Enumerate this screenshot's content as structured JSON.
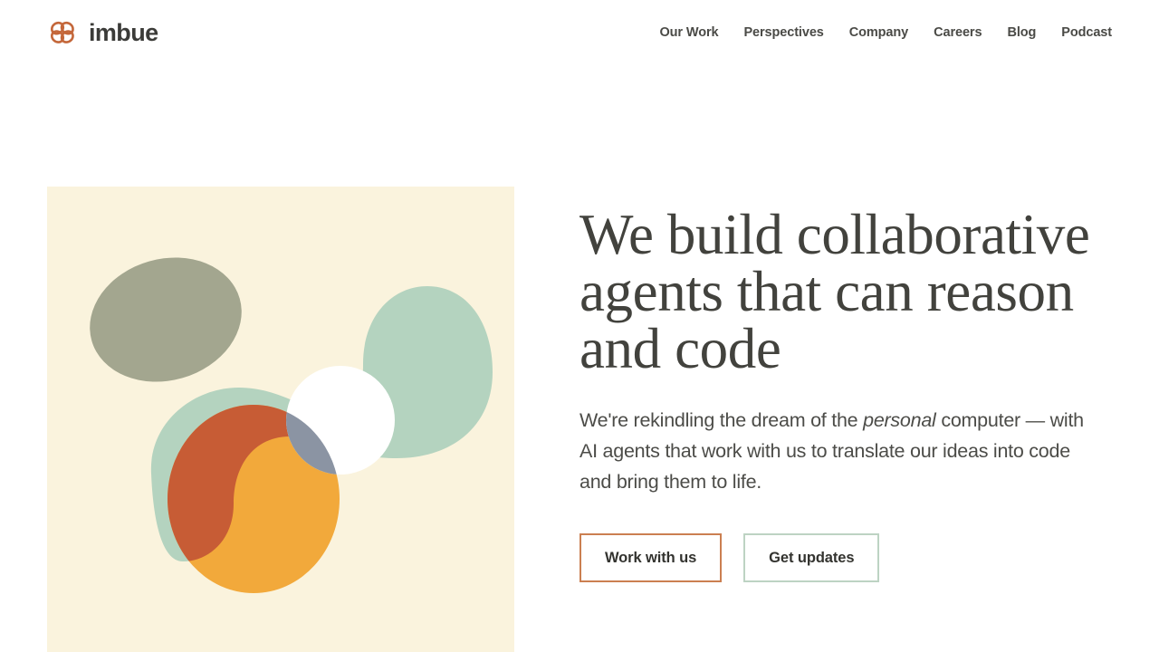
{
  "brand": {
    "name": "imbue",
    "logo_icon": "imbue-knot-icon",
    "logo_color": "#c4673a",
    "wordmark_color": "#3b3b38"
  },
  "nav": {
    "items": [
      {
        "label": "Our Work"
      },
      {
        "label": "Perspectives"
      },
      {
        "label": "Company"
      },
      {
        "label": "Careers"
      },
      {
        "label": "Blog"
      },
      {
        "label": "Podcast"
      }
    ]
  },
  "hero": {
    "title": "We build collaborative agents that can reason and code",
    "subtitle_part1": "We're rekindling the dream of the ",
    "subtitle_emphasis": "personal",
    "subtitle_part2": " computer — with AI agents that work with us to translate our ideas into code and bring them to life.",
    "buttons": [
      {
        "label": "Work with us",
        "border_color": "#cb7f51"
      },
      {
        "label": "Get updates",
        "border_color": "#bdd3c3"
      }
    ],
    "illustration": {
      "name": "abstract-overlapping-shapes-illustration",
      "background_color": "#faf3dd",
      "shapes": [
        {
          "name": "sage-grey-ellipse",
          "color": "#a3a68f"
        },
        {
          "name": "mint-wave-blob",
          "color": "#b4d3bf"
        },
        {
          "name": "white-circle",
          "color": "#ffffff"
        },
        {
          "name": "amber-ellipse",
          "color": "#f2a93b"
        },
        {
          "name": "terracotta-overlap",
          "color": "#c75c35"
        },
        {
          "name": "slate-overlap",
          "color": "#8b94a3"
        }
      ]
    }
  }
}
